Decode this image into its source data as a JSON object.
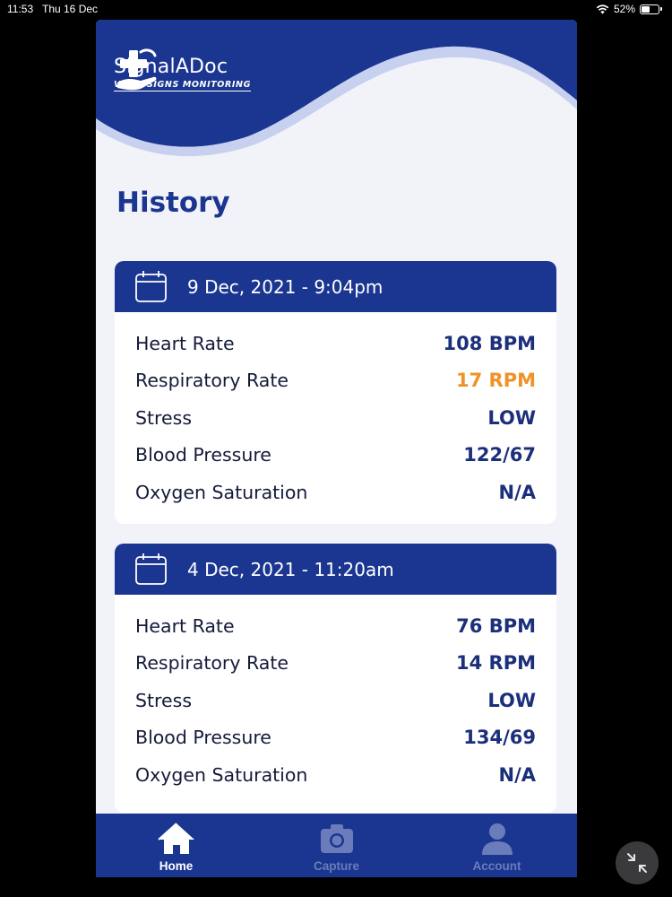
{
  "status_bar": {
    "time": "11:53",
    "date": "Thu 16 Dec",
    "battery": "52%",
    "battery_level": 0.52
  },
  "app": {
    "name": "SignalADoc",
    "tagline": "VITAL SIGNS MONITORING",
    "brand_color": "#1b3691",
    "warning_color": "#ef9228"
  },
  "page": {
    "title": "History"
  },
  "records": [
    {
      "date": "9 Dec, 2021 - 9:04pm",
      "rows": [
        {
          "label": "Heart Rate",
          "value": "108 BPM"
        },
        {
          "label": "Respiratory Rate",
          "value": "17 RPM",
          "status": "warning"
        },
        {
          "label": "Stress",
          "value": "LOW"
        },
        {
          "label": "Blood Pressure",
          "value": "122/67"
        },
        {
          "label": "Oxygen Saturation",
          "value": "N/A"
        }
      ]
    },
    {
      "date": "4 Dec, 2021 - 11:20am",
      "rows": [
        {
          "label": "Heart Rate",
          "value": "76 BPM"
        },
        {
          "label": "Respiratory Rate",
          "value": "14 RPM"
        },
        {
          "label": "Stress",
          "value": "LOW"
        },
        {
          "label": "Blood Pressure",
          "value": "134/69"
        },
        {
          "label": "Oxygen Saturation",
          "value": "N/A"
        }
      ]
    }
  ],
  "tabbar": {
    "items": [
      {
        "label": "Home",
        "icon": "home-icon",
        "active": true
      },
      {
        "label": "Capture",
        "icon": "camera-icon",
        "active": false
      },
      {
        "label": "Account",
        "icon": "user-icon",
        "active": false
      }
    ]
  }
}
